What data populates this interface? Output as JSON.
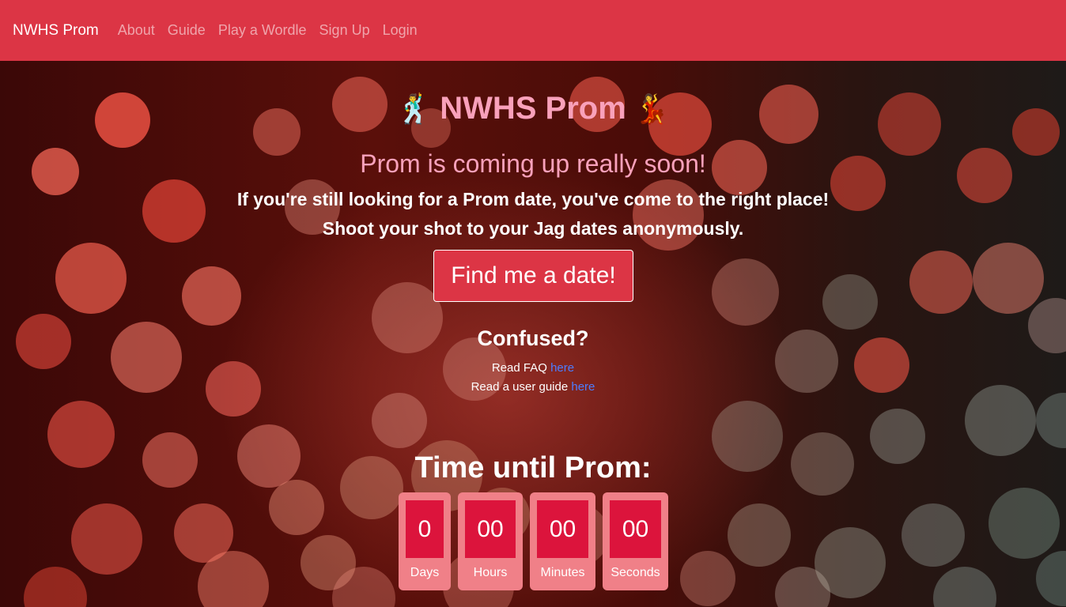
{
  "nav": {
    "brand": "NWHS Prom",
    "links": [
      "About",
      "Guide",
      "Play a Wordle",
      "Sign Up",
      "Login"
    ]
  },
  "hero": {
    "title": "NWHS Prom",
    "emoji_left": "🕺",
    "emoji_right": "💃",
    "subtitle": "Prom is coming up really soon!",
    "line1": "If you're still looking for a Prom date, you've come to the right place!",
    "line2": "Shoot your shot to your Jag dates anonymously.",
    "cta": "Find me a date!"
  },
  "help": {
    "heading": "Confused?",
    "faq_text": "Read FAQ",
    "faq_link": "here",
    "guide_text": "Read a user guide",
    "guide_link": "here"
  },
  "countdown": {
    "title": "Time until Prom:",
    "units": [
      {
        "value": "0",
        "label": "Days"
      },
      {
        "value": "00",
        "label": "Hours"
      },
      {
        "value": "00",
        "label": "Minutes"
      },
      {
        "value": "00",
        "label": "Seconds"
      }
    ]
  },
  "colors": {
    "navbar": "#dc3545",
    "accent_pink": "#f9a1bb",
    "countdown_box": "#f08088",
    "countdown_value": "#dc143c",
    "link": "#4d7dff"
  }
}
